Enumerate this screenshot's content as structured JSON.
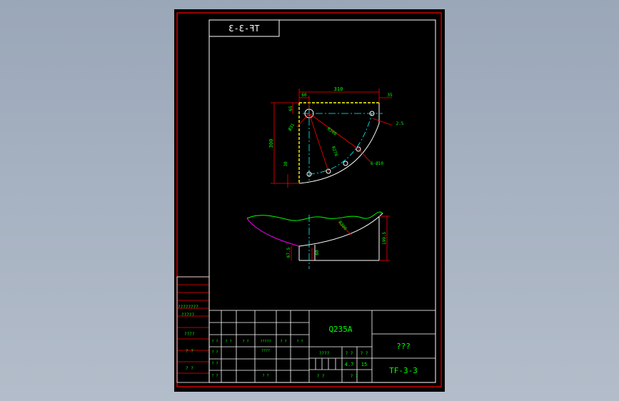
{
  "colors": {
    "background": "#000000",
    "border": "#ff0000",
    "frame": "#ffffff",
    "dimension": "#ff0000",
    "dim_text": "#00ff00",
    "centerline": "#00ffff",
    "hidden": "#ffff00",
    "profile": "#00ff00",
    "arc": "#ff00ff"
  },
  "drawing_code_top": "TF-3-3",
  "dimensions": {
    "top_width": "310",
    "top_left": "60",
    "top_right": "35",
    "left_top": "65",
    "left_height": "300",
    "left_bottom": "30",
    "radius_circle": "Ø31",
    "radius_r1": "R300",
    "radius_r2": "R276",
    "holes": "6-Ø10",
    "chamfer": "2.5",
    "profile_r": "R300",
    "lower_h": "67.5",
    "lower_w": "60",
    "lower_right": "199.5"
  },
  "title_block": {
    "side_labels": [
      "????????",
      "?????",
      "????",
      "? ?",
      "? ?"
    ],
    "grid_row1": [
      "? ?",
      "? ?",
      "? ?",
      "?????",
      "? ?",
      "? ?"
    ],
    "grid_row2": [
      "? ?",
      "????",
      "? ?"
    ],
    "grid_row3": [
      "? ?",
      "? ?"
    ],
    "material": "Q235A",
    "scale_label": "????",
    "col_a": "? ?",
    "col_b": "? ?",
    "weight": "4.7",
    "scale_value": "15",
    "bottom_label_1": "? ?",
    "bottom_label_2": "? ?",
    "part_name": "???",
    "drawing_number": "TF-3-3"
  }
}
